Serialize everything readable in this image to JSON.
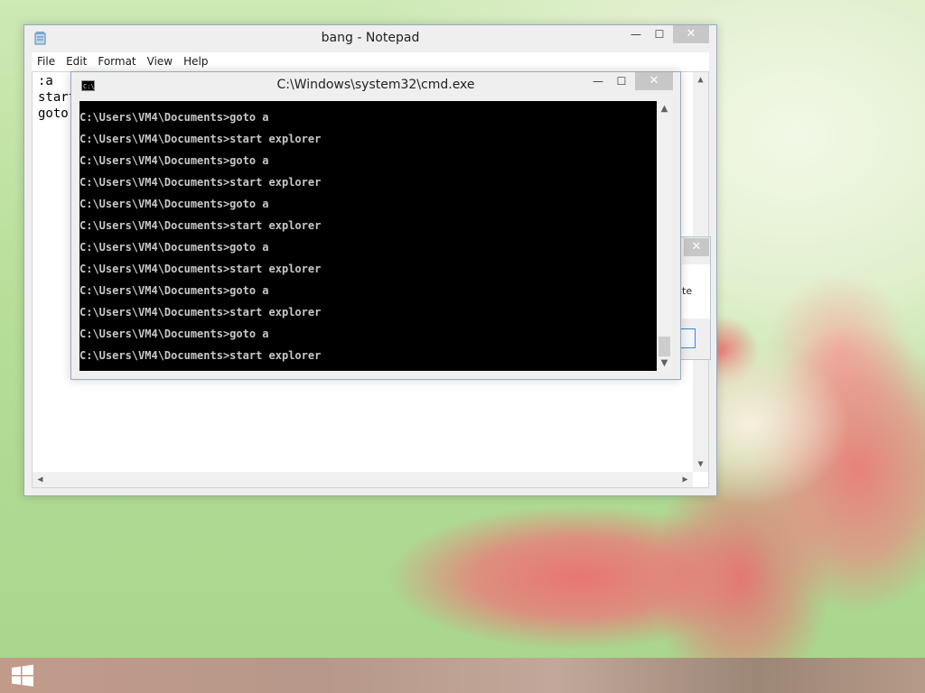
{
  "notepad": {
    "title": "bang - Notepad",
    "menu": [
      "File",
      "Edit",
      "Format",
      "View",
      "Help"
    ],
    "lines": [
      ":a",
      "start",
      "goto"
    ],
    "controls": {
      "minimize": "—",
      "maximize": "☐",
      "close": "✕"
    }
  },
  "dialog": {
    "close": "✕",
    "text_fragment": "te"
  },
  "cmd": {
    "title": "C:\\Windows\\system32\\cmd.exe",
    "icon_label": "C:\\",
    "controls": {
      "minimize": "—",
      "maximize": "☐",
      "close": "✕"
    },
    "lines": [
      "C:\\Users\\VM4\\Documents>goto a",
      "C:\\Users\\VM4\\Documents>start explorer",
      "C:\\Users\\VM4\\Documents>goto a",
      "C:\\Users\\VM4\\Documents>start explorer",
      "C:\\Users\\VM4\\Documents>goto a",
      "C:\\Users\\VM4\\Documents>start explorer",
      "C:\\Users\\VM4\\Documents>goto a",
      "C:\\Users\\VM4\\Documents>start explorer",
      "C:\\Users\\VM4\\Documents>goto a",
      "C:\\Users\\VM4\\Documents>start explorer",
      "C:\\Users\\VM4\\Documents>goto a",
      "C:\\Users\\VM4\\Documents>start explorer"
    ]
  },
  "taskbar": {
    "start_icon": "windows-logo-icon"
  },
  "colors": {
    "console_bg": "#000000",
    "console_text": "#c8c8c8",
    "window_frame": "#efefef",
    "close_button": "#c7c7c7",
    "dialog_button_border": "#3c86d6"
  }
}
